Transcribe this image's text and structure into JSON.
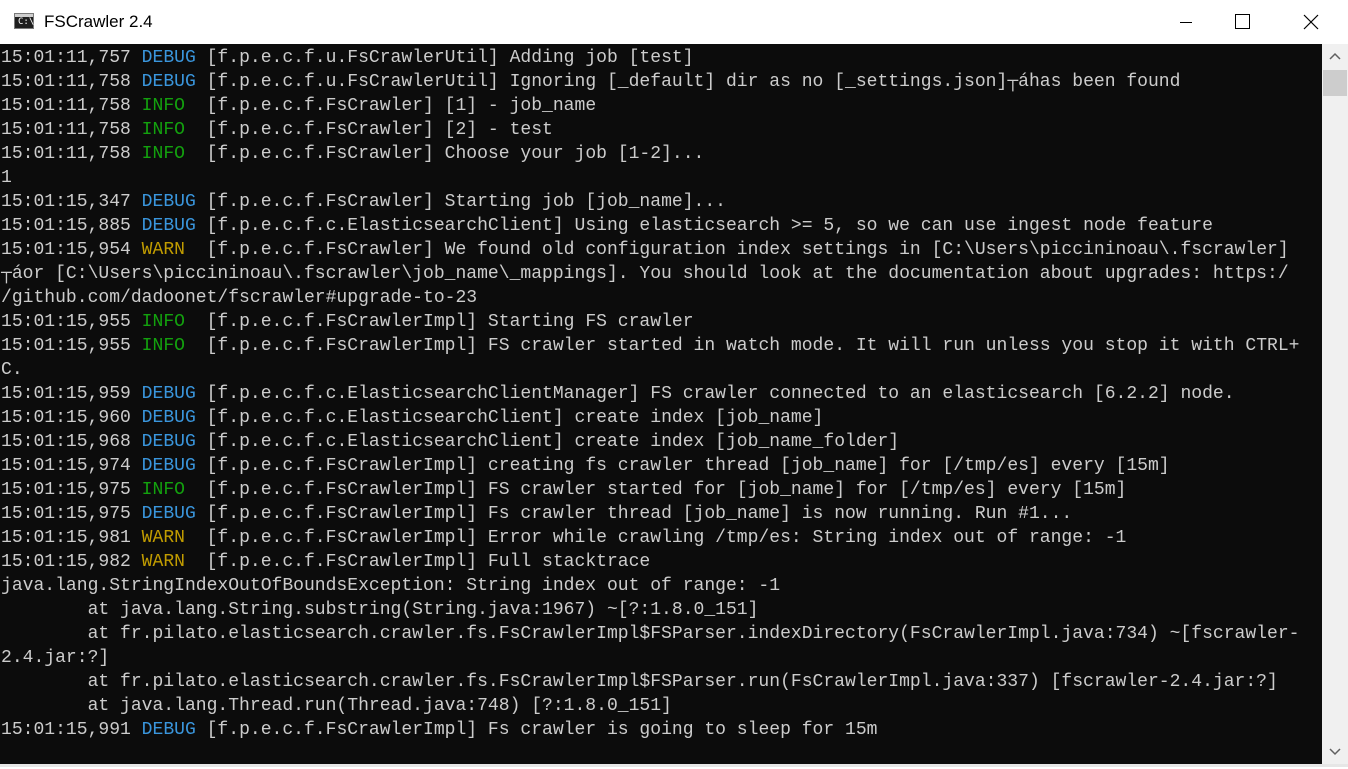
{
  "window": {
    "title": "FSCrawler 2.4",
    "icon_glyph": "C:\\"
  },
  "icons": {
    "app": "console-app-icon",
    "minimize": "minimize-icon",
    "maximize": "maximize-icon",
    "close": "close-icon",
    "scroll_up": "chevron-up-icon",
    "scroll_down": "chevron-down-icon"
  },
  "colors": {
    "console_background": "#0c0c0c",
    "default_text": "#cccccc",
    "debug": "#3a96dd",
    "info": "#13a10e",
    "warn": "#c19c00"
  },
  "console": {
    "lines": [
      {
        "time": "15:01:11,757 ",
        "level": "DEBUG",
        "level_class": "lv-debug",
        "message": " [f.p.e.c.f.u.FsCrawlerUtil] Adding job [test]"
      },
      {
        "time": "15:01:11,758 ",
        "level": "DEBUG",
        "level_class": "lv-debug",
        "message": " [f.p.e.c.f.u.FsCrawlerUtil] Ignoring [_default] dir as no [_settings.json]┬áhas been found"
      },
      {
        "time": "15:01:11,758 ",
        "level": "INFO ",
        "level_class": "lv-info",
        "message": " [f.p.e.c.f.FsCrawler] [1] - job_name"
      },
      {
        "time": "15:01:11,758 ",
        "level": "INFO ",
        "level_class": "lv-info",
        "message": " [f.p.e.c.f.FsCrawler] [2] - test"
      },
      {
        "time": "15:01:11,758 ",
        "level": "INFO ",
        "level_class": "lv-info",
        "message": " [f.p.e.c.f.FsCrawler] Choose your job [1-2]..."
      },
      {
        "time": "",
        "level": "",
        "level_class": "",
        "message": "1"
      },
      {
        "time": "15:01:15,347 ",
        "level": "DEBUG",
        "level_class": "lv-debug",
        "message": " [f.p.e.c.f.FsCrawler] Starting job [job_name]..."
      },
      {
        "time": "15:01:15,885 ",
        "level": "DEBUG",
        "level_class": "lv-debug",
        "message": " [f.p.e.c.f.c.ElasticsearchClient] Using elasticsearch >= 5, so we can use ingest node feature"
      },
      {
        "time": "15:01:15,954 ",
        "level": "WARN ",
        "level_class": "lv-warn",
        "message": " [f.p.e.c.f.FsCrawler] We found old configuration index settings in [C:\\Users\\piccininoau\\.fscrawler]"
      },
      {
        "time": "",
        "level": "",
        "level_class": "",
        "message": "┬áor [C:\\Users\\piccininoau\\.fscrawler\\job_name\\_mappings]. You should look at the documentation about upgrades: https:/"
      },
      {
        "time": "",
        "level": "",
        "level_class": "",
        "message": "/github.com/dadoonet/fscrawler#upgrade-to-23"
      },
      {
        "time": "15:01:15,955 ",
        "level": "INFO ",
        "level_class": "lv-info",
        "message": " [f.p.e.c.f.FsCrawlerImpl] Starting FS crawler"
      },
      {
        "time": "15:01:15,955 ",
        "level": "INFO ",
        "level_class": "lv-info",
        "message": " [f.p.e.c.f.FsCrawlerImpl] FS crawler started in watch mode. It will run unless you stop it with CTRL+"
      },
      {
        "time": "",
        "level": "",
        "level_class": "",
        "message": "C."
      },
      {
        "time": "15:01:15,959 ",
        "level": "DEBUG",
        "level_class": "lv-debug",
        "message": " [f.p.e.c.f.c.ElasticsearchClientManager] FS crawler connected to an elasticsearch [6.2.2] node."
      },
      {
        "time": "15:01:15,960 ",
        "level": "DEBUG",
        "level_class": "lv-debug",
        "message": " [f.p.e.c.f.c.ElasticsearchClient] create index [job_name]"
      },
      {
        "time": "15:01:15,968 ",
        "level": "DEBUG",
        "level_class": "lv-debug",
        "message": " [f.p.e.c.f.c.ElasticsearchClient] create index [job_name_folder]"
      },
      {
        "time": "15:01:15,974 ",
        "level": "DEBUG",
        "level_class": "lv-debug",
        "message": " [f.p.e.c.f.FsCrawlerImpl] creating fs crawler thread [job_name] for [/tmp/es] every [15m]"
      },
      {
        "time": "15:01:15,975 ",
        "level": "INFO ",
        "level_class": "lv-info",
        "message": " [f.p.e.c.f.FsCrawlerImpl] FS crawler started for [job_name] for [/tmp/es] every [15m]"
      },
      {
        "time": "15:01:15,975 ",
        "level": "DEBUG",
        "level_class": "lv-debug",
        "message": " [f.p.e.c.f.FsCrawlerImpl] Fs crawler thread [job_name] is now running. Run #1..."
      },
      {
        "time": "15:01:15,981 ",
        "level": "WARN ",
        "level_class": "lv-warn",
        "message": " [f.p.e.c.f.FsCrawlerImpl] Error while crawling /tmp/es: String index out of range: -1"
      },
      {
        "time": "15:01:15,982 ",
        "level": "WARN ",
        "level_class": "lv-warn",
        "message": " [f.p.e.c.f.FsCrawlerImpl] Full stacktrace"
      },
      {
        "time": "",
        "level": "",
        "level_class": "",
        "message": "java.lang.StringIndexOutOfBoundsException: String index out of range: -1"
      },
      {
        "time": "",
        "level": "",
        "level_class": "",
        "message": "        at java.lang.String.substring(String.java:1967) ~[?:1.8.0_151]"
      },
      {
        "time": "",
        "level": "",
        "level_class": "",
        "message": "        at fr.pilato.elasticsearch.crawler.fs.FsCrawlerImpl$FSParser.indexDirectory(FsCrawlerImpl.java:734) ~[fscrawler-"
      },
      {
        "time": "",
        "level": "",
        "level_class": "",
        "message": "2.4.jar:?]"
      },
      {
        "time": "",
        "level": "",
        "level_class": "",
        "message": "        at fr.pilato.elasticsearch.crawler.fs.FsCrawlerImpl$FSParser.run(FsCrawlerImpl.java:337) [fscrawler-2.4.jar:?]"
      },
      {
        "time": "",
        "level": "",
        "level_class": "",
        "message": "        at java.lang.Thread.run(Thread.java:748) [?:1.8.0_151]"
      },
      {
        "time": "15:01:15,991 ",
        "level": "DEBUG",
        "level_class": "lv-debug",
        "message": " [f.p.e.c.f.FsCrawlerImpl] Fs crawler is going to sleep for 15m"
      }
    ]
  }
}
